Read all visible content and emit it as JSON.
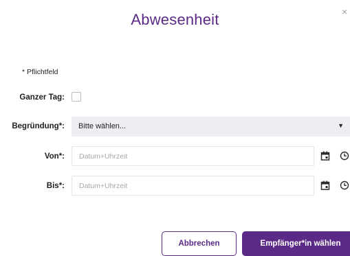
{
  "dialog": {
    "title": "Abwesenheit",
    "close_label": "×",
    "required_note": "* Pflichtfeld"
  },
  "fields": {
    "full_day": {
      "label": "Ganzer Tag:",
      "checked": false
    },
    "reason": {
      "label": "Begründung*:",
      "value": "Bitte wählen..."
    },
    "from": {
      "label": "Von*:",
      "placeholder": "Datum+Uhrzeit"
    },
    "to": {
      "label": "Bis*:",
      "placeholder": "Datum+Uhrzeit"
    }
  },
  "buttons": {
    "cancel": "Abbrechen",
    "choose_recipient": "Empfänger*in wählen"
  },
  "icons": {
    "calendar": "calendar-icon",
    "clock": "clock-icon",
    "dropdown": "caret-down-icon"
  },
  "colors": {
    "accent": "#5b2a86",
    "select_bg": "#efedf1"
  }
}
